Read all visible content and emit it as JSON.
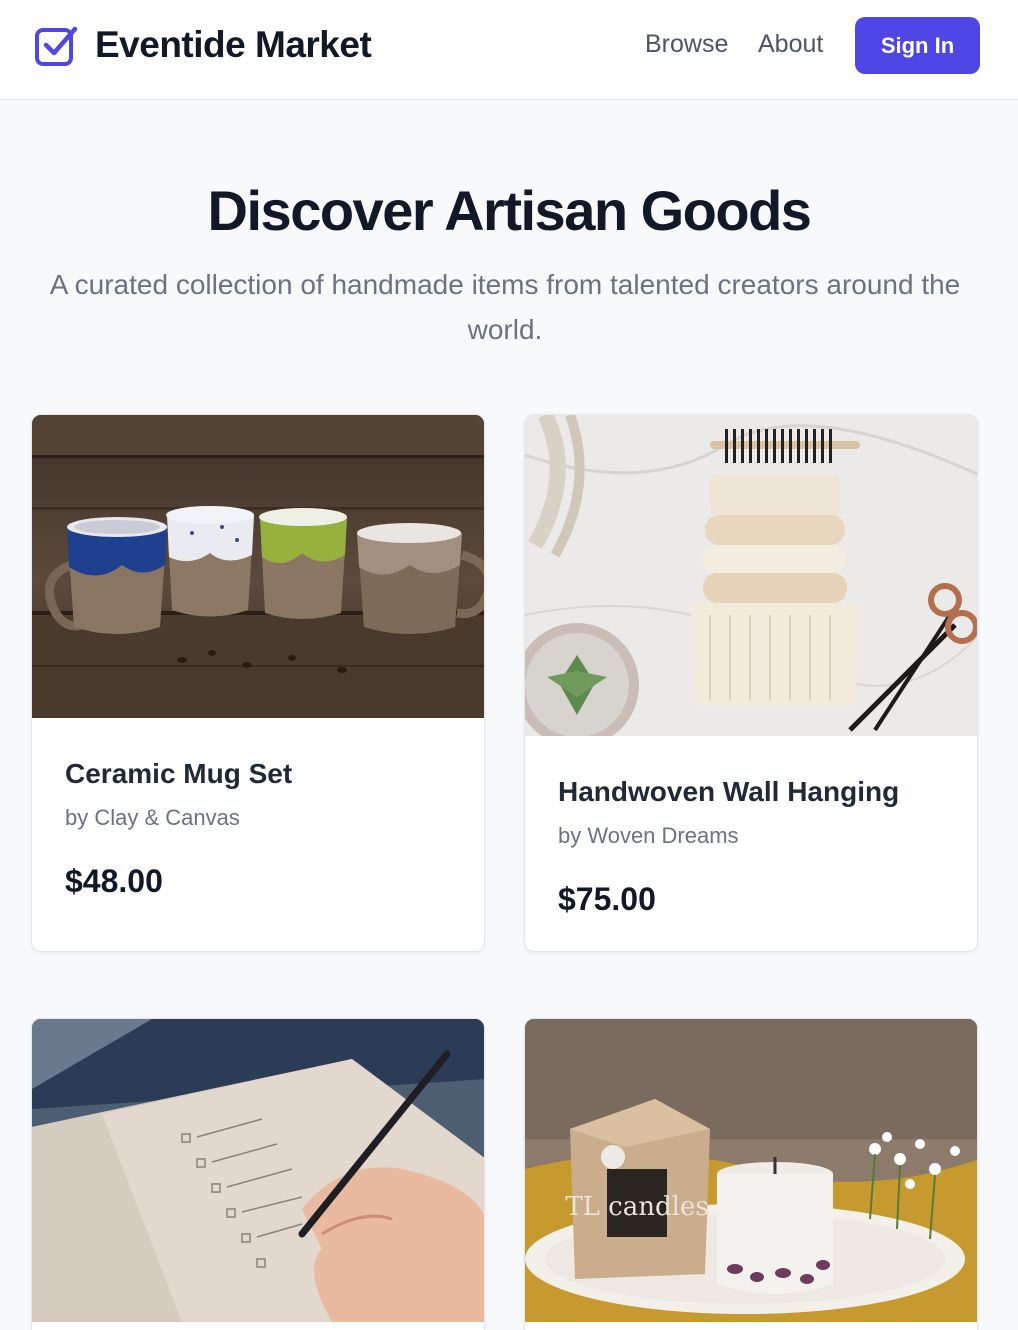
{
  "header": {
    "brand": "Eventide Market",
    "logo_icon": "checkbox-check-icon",
    "nav": [
      "Browse",
      "About"
    ],
    "signin_label": "Sign In",
    "accent_color": "#4f46e5"
  },
  "hero": {
    "title": "Discover Artisan Goods",
    "subtitle": "A curated collection of handmade items from talented creators around the world."
  },
  "products": [
    {
      "title": "Ceramic Mug Set",
      "maker": "by Clay & Canvas",
      "price": "$48.00",
      "image": "ceramic-mugs-photo"
    },
    {
      "title": "Handwoven Wall Hanging",
      "maker": "by Woven Dreams",
      "price": "$75.00",
      "image": "woven-wall-hanging-photo"
    },
    {
      "title": "",
      "maker": "",
      "price": "",
      "image": "handwritten-notebook-photo"
    },
    {
      "title": "",
      "maker": "",
      "price": "",
      "image": "candle-with-box-photo",
      "box_label": "TL candles"
    }
  ]
}
